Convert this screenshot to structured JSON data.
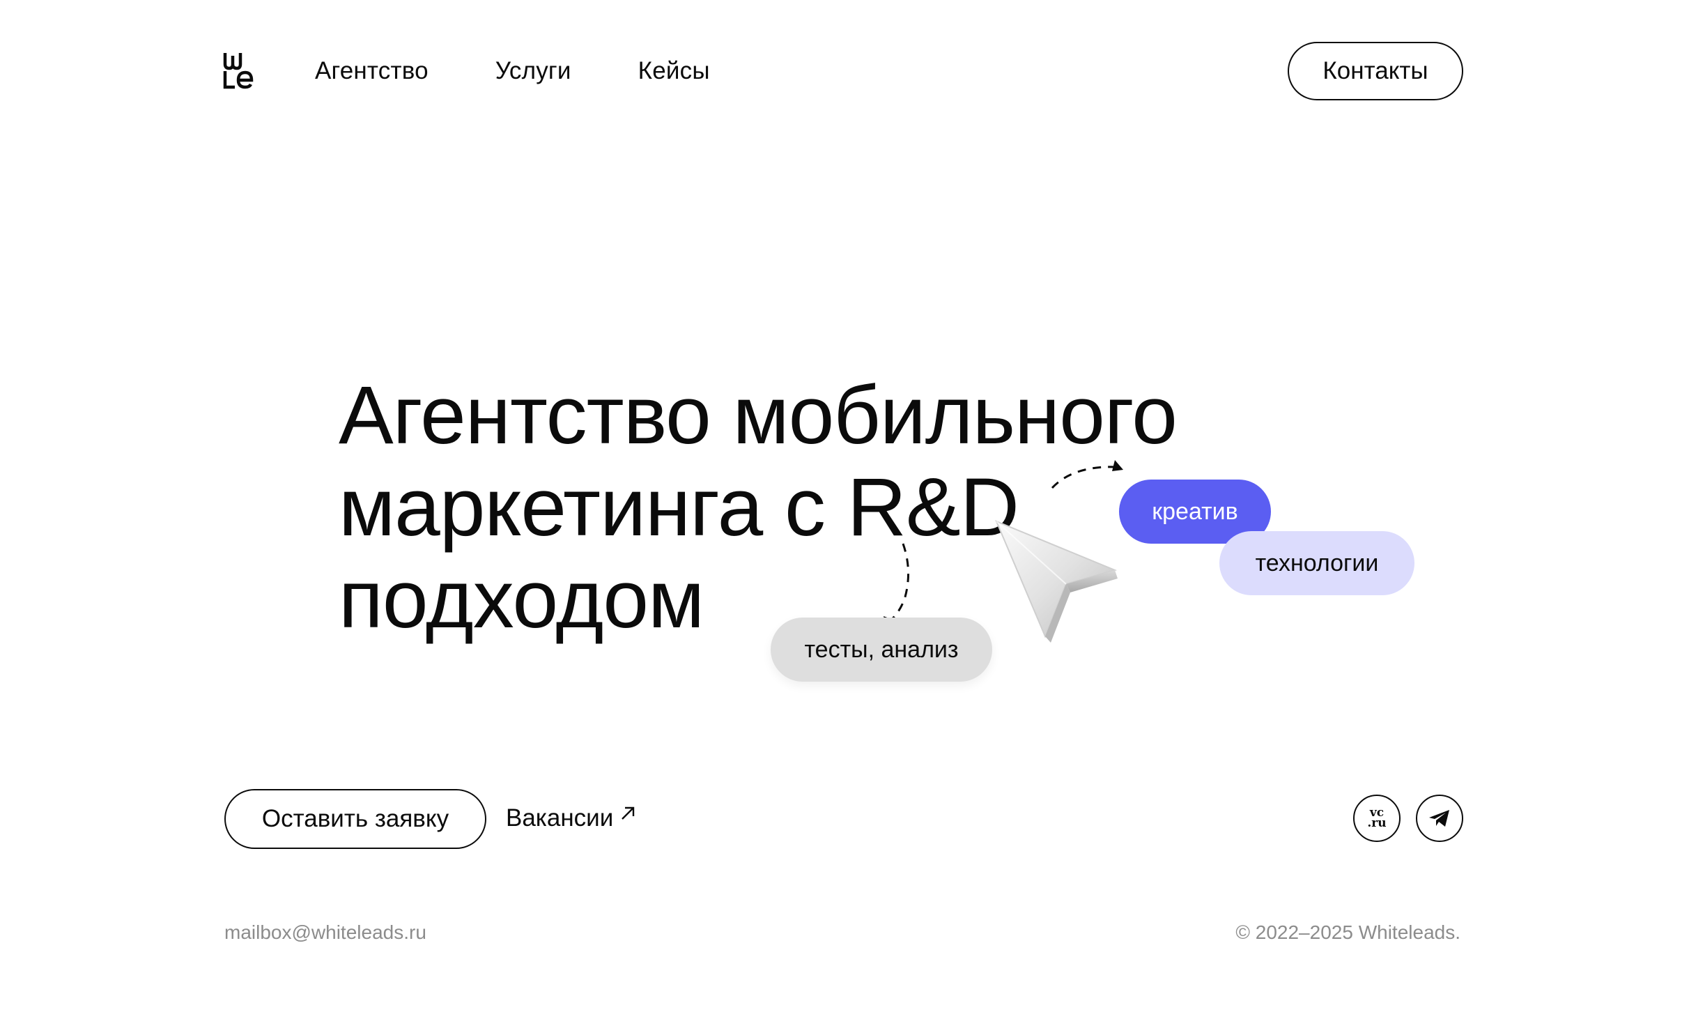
{
  "header": {
    "logo_text": "WLe",
    "nav": [
      {
        "label": "Агентство"
      },
      {
        "label": "Услуги"
      },
      {
        "label": "Кейсы"
      }
    ],
    "contacts_label": "Контакты"
  },
  "hero": {
    "title_lines": [
      "Агентство мобильного",
      "маркетинга с R&D",
      "подходом"
    ],
    "pills": {
      "creative": "креатив",
      "tech": "технологии",
      "tests": "тесты, анализ"
    }
  },
  "actions": {
    "apply_label": "Оставить заявку",
    "vacancies_label": "Вакансии"
  },
  "social": {
    "vc_top": "vc",
    "vc_bottom": ".ru",
    "icons": [
      "vc-ru-icon",
      "telegram-icon"
    ]
  },
  "footer": {
    "email": "mailbox@whiteleads.ru",
    "copyright": "© 2022–2025 Whiteleads."
  },
  "colors": {
    "accent": "#5b5ef2",
    "accent_light": "#dcdcfd",
    "grey_pill": "#dedede",
    "muted_text": "#8c8c8c"
  }
}
